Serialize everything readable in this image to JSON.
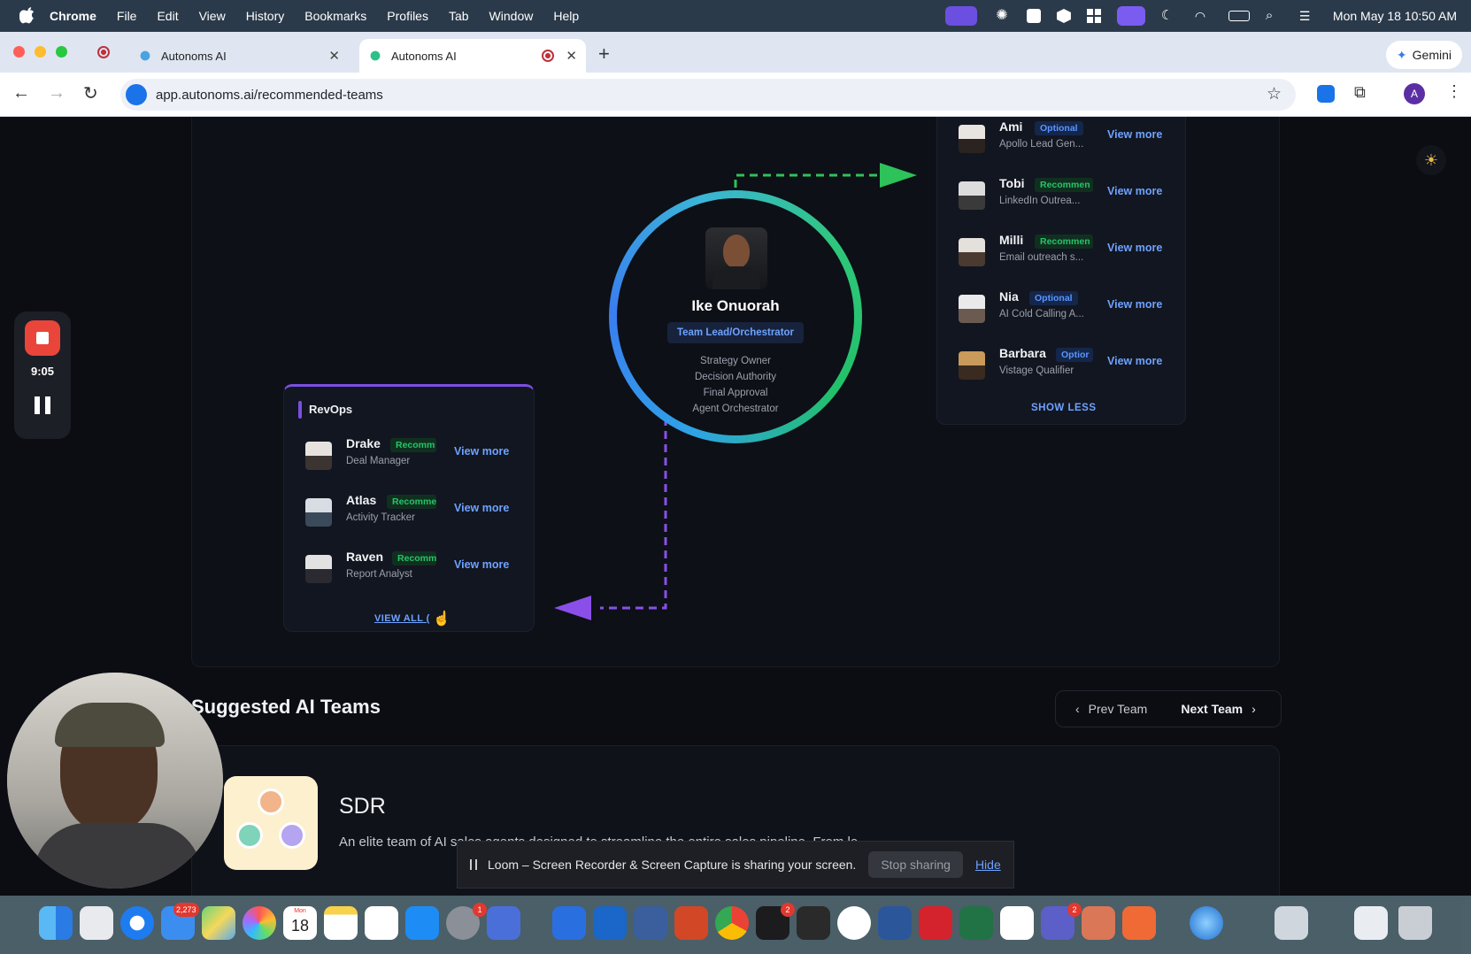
{
  "menubar": {
    "app": "Chrome",
    "items": [
      "File",
      "Edit",
      "View",
      "History",
      "Bookmarks",
      "Profiles",
      "Tab",
      "Window",
      "Help"
    ],
    "clock": "Mon May 18  10:50 AM"
  },
  "browser": {
    "tabs": [
      {
        "title": "Autonoms AI"
      },
      {
        "title": "Autonoms AI"
      }
    ],
    "url": "app.autonoms.ai/recommended-teams",
    "gemini_label": "Gemini",
    "profile_initial": "A"
  },
  "lead": {
    "name": "Ike Onuorah",
    "title": "Team Lead/Orchestrator",
    "duties": [
      "Strategy Owner",
      "Decision Authority",
      "Final Approval",
      "Agent Orchestrator"
    ]
  },
  "right_team": {
    "members": [
      {
        "name": "Ami",
        "badge": "Optional",
        "badge_type": "optional",
        "role": "Apollo Lead Gen...",
        "action": "View more"
      },
      {
        "name": "Tobi",
        "badge": "Recommen",
        "badge_type": "recommended",
        "role": "LinkedIn Outrea...",
        "action": "View more"
      },
      {
        "name": "Milli",
        "badge": "Recommen",
        "badge_type": "recommended",
        "role": "Email outreach s...",
        "action": "View more"
      },
      {
        "name": "Nia",
        "badge": "Optional",
        "badge_type": "optional",
        "role": "AI Cold Calling A...",
        "action": "View more"
      },
      {
        "name": "Barbara",
        "badge": "Optior",
        "badge_type": "optional",
        "role": "Vistage Qualifier",
        "action": "View more"
      }
    ],
    "toggle_label": "SHOW LESS"
  },
  "revops": {
    "title": "RevOps",
    "members": [
      {
        "name": "Drake",
        "badge": "Recomm",
        "role": "Deal Manager",
        "action": "View more"
      },
      {
        "name": "Atlas",
        "badge": "Recomme",
        "role": "Activity Tracker",
        "action": "View more"
      },
      {
        "name": "Raven",
        "badge": "Recomm",
        "role": "Report Analyst",
        "action": "View more"
      }
    ],
    "view_all_label": "VIEW ALL ("
  },
  "suggested": {
    "title": "Suggested AI Teams",
    "prev_label": "Prev Team",
    "next_label": "Next Team",
    "team_name": "SDR",
    "team_description": "An elite team of AI sales agents designed to streamline the entire sales pipeline. From le..."
  },
  "loom": {
    "timer": "9:05",
    "share_message": "Loom – Screen Recorder & Screen Capture is sharing your screen.",
    "stop_label": "Stop sharing",
    "hide_label": "Hide"
  },
  "dock": {
    "badges": {
      "mail": "2,273",
      "calendar_day": "18",
      "calendar_month": "Mon",
      "settings": "1",
      "terminal": "2",
      "teams": "2"
    }
  },
  "colors": {
    "accent_blue": "#6ea2ff",
    "recommended_green": "#27c46a",
    "optional_blue": "#5b95ff",
    "revops_purple": "#7b4fe0",
    "arrow_green": "#2ec25a",
    "arrow_purple": "#8a4fe8"
  }
}
